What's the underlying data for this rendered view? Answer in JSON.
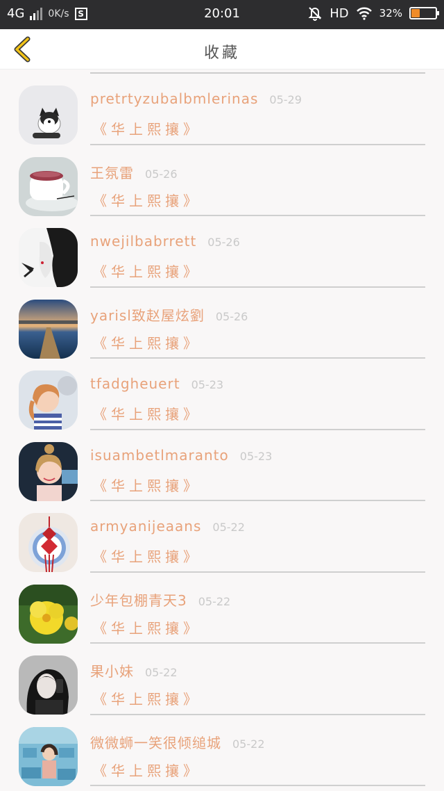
{
  "status": {
    "network": "4G",
    "speed": "0K/s",
    "s_icon": "S",
    "time": "20:01",
    "hd": "HD",
    "battery_pct": "32%",
    "battery_level": 0.32,
    "icons": [
      "signal-icon",
      "mute-bell-icon",
      "wifi-icon",
      "battery-icon"
    ]
  },
  "header": {
    "title": "收藏",
    "back_icon": "chevron-left-icon",
    "accent": "#f2c318"
  },
  "items": [
    {
      "name": "pretrtyzubalbmlerinas",
      "date": "05-29",
      "sub": "《华上熙攘》"
    },
    {
      "name": "王氛雷",
      "date": "05-26",
      "sub": "《华上熙攘》"
    },
    {
      "name": "nwejilbabrrett",
      "date": "05-26",
      "sub": "《华上熙攘》"
    },
    {
      "name": "yarisl致赵屋炫劉",
      "date": "05-26",
      "sub": "《华上熙攘》"
    },
    {
      "name": "tfadgheuert",
      "date": "05-23",
      "sub": "《华上熙攘》"
    },
    {
      "name": "isuambetlmaranto",
      "date": "05-23",
      "sub": "《华上熙攘》"
    },
    {
      "name": "armyanijeaans",
      "date": "05-22",
      "sub": "《华上熙攘》"
    },
    {
      "name": "少年包棚青天3",
      "date": "05-22",
      "sub": "《华上熙攘》"
    },
    {
      "name": "果小妹",
      "date": "05-22",
      "sub": "《华上熙攘》"
    },
    {
      "name": "微微蛳一笑很倾缒城",
      "date": "05-22",
      "sub": "《华上熙攘》"
    }
  ]
}
